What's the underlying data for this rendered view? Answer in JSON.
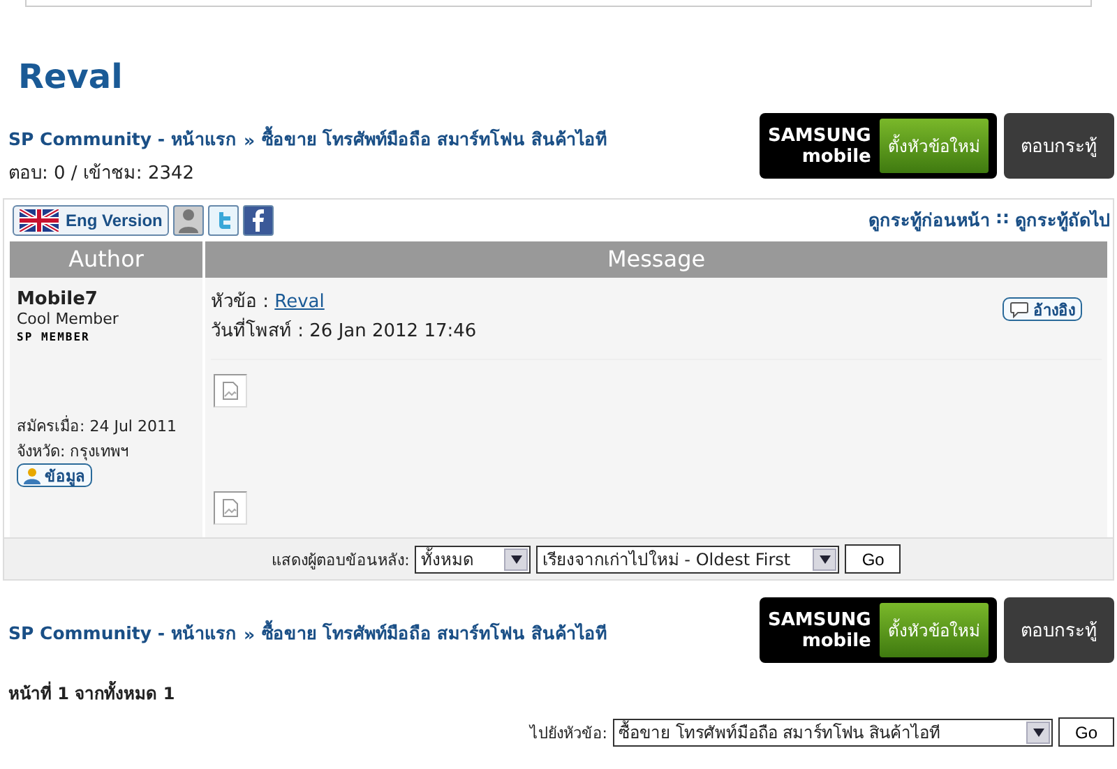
{
  "title": "Reval",
  "breadcrumb_top": [
    "SP Community - หน้าแรก",
    "»",
    "ซื้อขาย โทรศัพท์มือถือ สมาร์ทโฟน สินค้าไอที"
  ],
  "stats": "ตอบ: 0 / เข้าชม: 2342",
  "action_buttons": [
    {
      "kind": "new",
      "brand": "SAMSUNG",
      "sub": "mobile",
      "label": "ตั้งหัวข้อใหม่"
    },
    {
      "kind": "reply",
      "label": "ตอบกระทู้"
    }
  ],
  "toolbar": {
    "language": "Eng Version",
    "nav": [
      "ดูกระทู้ก่อนหน้า",
      "::",
      "ดูกระทู้ถัดไป"
    ]
  },
  "table": {
    "columns": [
      "Author",
      "Message"
    ],
    "post": {
      "author": "Mobile7",
      "rank": "Cool Member",
      "badge": "SP MEMBER",
      "joined": "สมัครเมื่อ: 24 Jul 2011",
      "province": "จังหวัด: กรุงเทพฯ",
      "profile_button": "ข้อมูล",
      "subject_label": "หัวข้อ : ",
      "subject": "Reval",
      "date": "วันที่โพสท์ : 26 Jan 2012 17:46",
      "quote_button": "อ้างอิง",
      "images": [
        {
          "kind": "broken_image"
        },
        {
          "kind": "broken_image"
        }
      ]
    }
  },
  "filter": {
    "label": "แสดงผู้ตอบข้อนหลัง:",
    "period": "ทั้งหมด",
    "order": "เรียงจากเก่าไปใหม่ - Oldest First",
    "go": "Go"
  },
  "breadcrumb_bottom": [
    "SP Community - หน้าแรก",
    "»",
    "ซื้อขาย โทรศัพท์มือถือ สมาร์ทโฟน สินค้าไอที"
  ],
  "action_buttons_bottom": [
    {
      "kind": "new",
      "brand": "SAMSUNG",
      "sub": "mobile",
      "label": "ตั้งหัวข้อใหม่"
    },
    {
      "kind": "reply",
      "label": "ตอบกระทู้"
    }
  ],
  "pagination": "หน้าที่ 1 จากทั้งหมด 1",
  "jump": {
    "label": "ไปยังหัวข้อ:",
    "value": "ซื้อขาย โทรศัพท์มือถือ สมาร์ทโฟน สินค้าไอที",
    "go": "Go"
  }
}
